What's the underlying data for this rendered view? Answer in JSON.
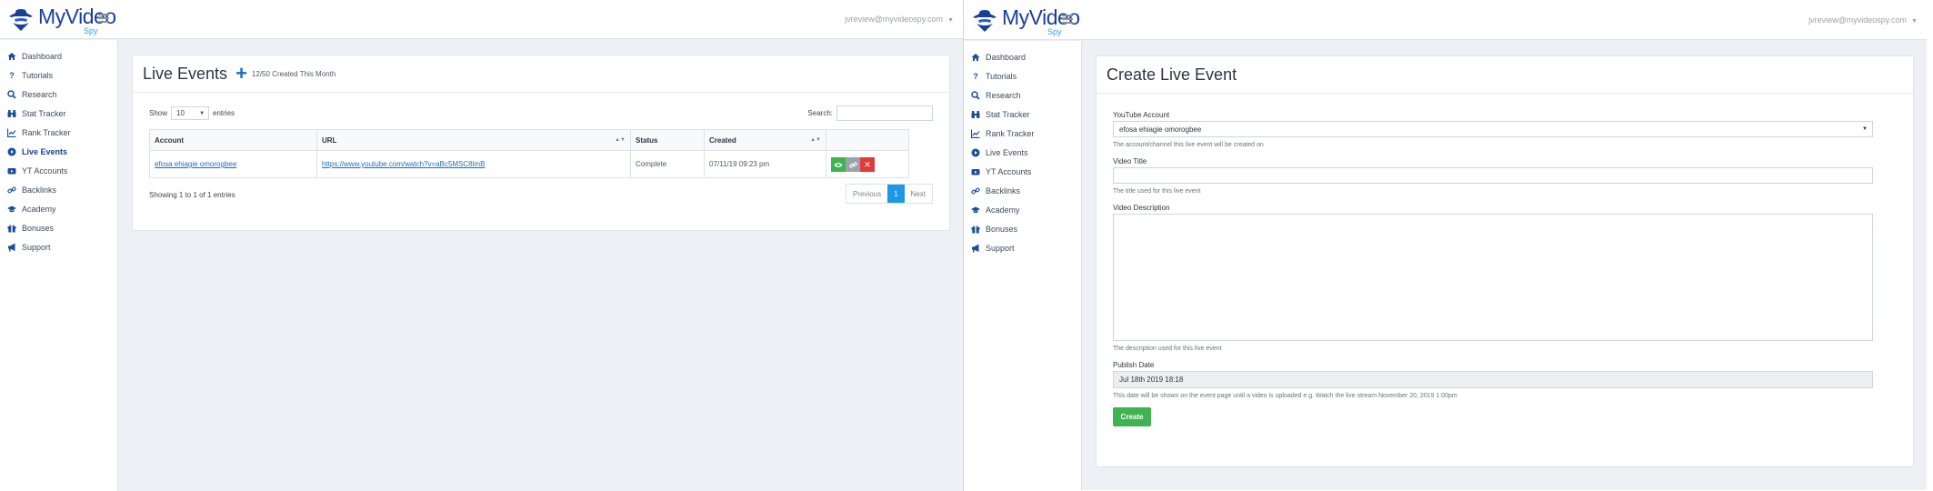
{
  "brand": {
    "name": "MyVideo",
    "sub": "Spy"
  },
  "user": {
    "email": "jvreview@myvideospy.com"
  },
  "nav": {
    "items": [
      {
        "label": "Dashboard",
        "icon": "home-icon"
      },
      {
        "label": "Tutorials",
        "icon": "question-icon"
      },
      {
        "label": "Research",
        "icon": "search-icon"
      },
      {
        "label": "Stat Tracker",
        "icon": "binoculars-icon"
      },
      {
        "label": "Rank Tracker",
        "icon": "line-chart-icon"
      },
      {
        "label": "Live Events",
        "icon": "play-circle-icon"
      },
      {
        "label": "YT Accounts",
        "icon": "youtube-icon"
      },
      {
        "label": "Backlinks",
        "icon": "link-icon"
      },
      {
        "label": "Academy",
        "icon": "graduation-cap-icon"
      },
      {
        "label": "Bonuses",
        "icon": "gift-icon"
      },
      {
        "label": "Support",
        "icon": "bullhorn-icon"
      }
    ],
    "active": "Live Events"
  },
  "live_events": {
    "title": "Live Events",
    "created_count": "12/50 Created This Month",
    "show_label": "Show",
    "page_length": "10",
    "entries_label": "entries",
    "search_label": "Search:",
    "columns": [
      "Account",
      "URL",
      "Status",
      "Created",
      ""
    ],
    "rows": [
      {
        "account": "efosa ehiagie omorogbee",
        "url": "https://www.youtube.com/watch?v=aBc5MSC8lmB",
        "status": "Complete",
        "created": "07/11/19 09:23 pm"
      }
    ],
    "info": "Showing 1 to 1 of 1 entries",
    "pager": {
      "prev": "Previous",
      "current": "1",
      "next": "Next"
    }
  },
  "create_event": {
    "title": "Create Live Event",
    "account_label": "YouTube Account",
    "account_value": "efosa ehiagie omorogbee",
    "account_help": "The account/channel this live event will be created on",
    "video_title_label": "Video Title",
    "video_title_value": "",
    "video_title_help": "The title used for this live event",
    "description_label": "Video Description",
    "description_help": "The description used for this live event",
    "publish_label": "Publish Date",
    "publish_value": "Jul 18th 2019 18:18",
    "publish_help": "This date will be shown on the event page until a video is uploaded e.g. Watch the live stream November 20, 2019 1:00pm",
    "create_button": "Create"
  },
  "colors": {
    "brand_blue": "#1a3f9a",
    "accent_blue": "#1d98e6",
    "success_green": "#3fb34f",
    "danger_red": "#e03b3b"
  }
}
